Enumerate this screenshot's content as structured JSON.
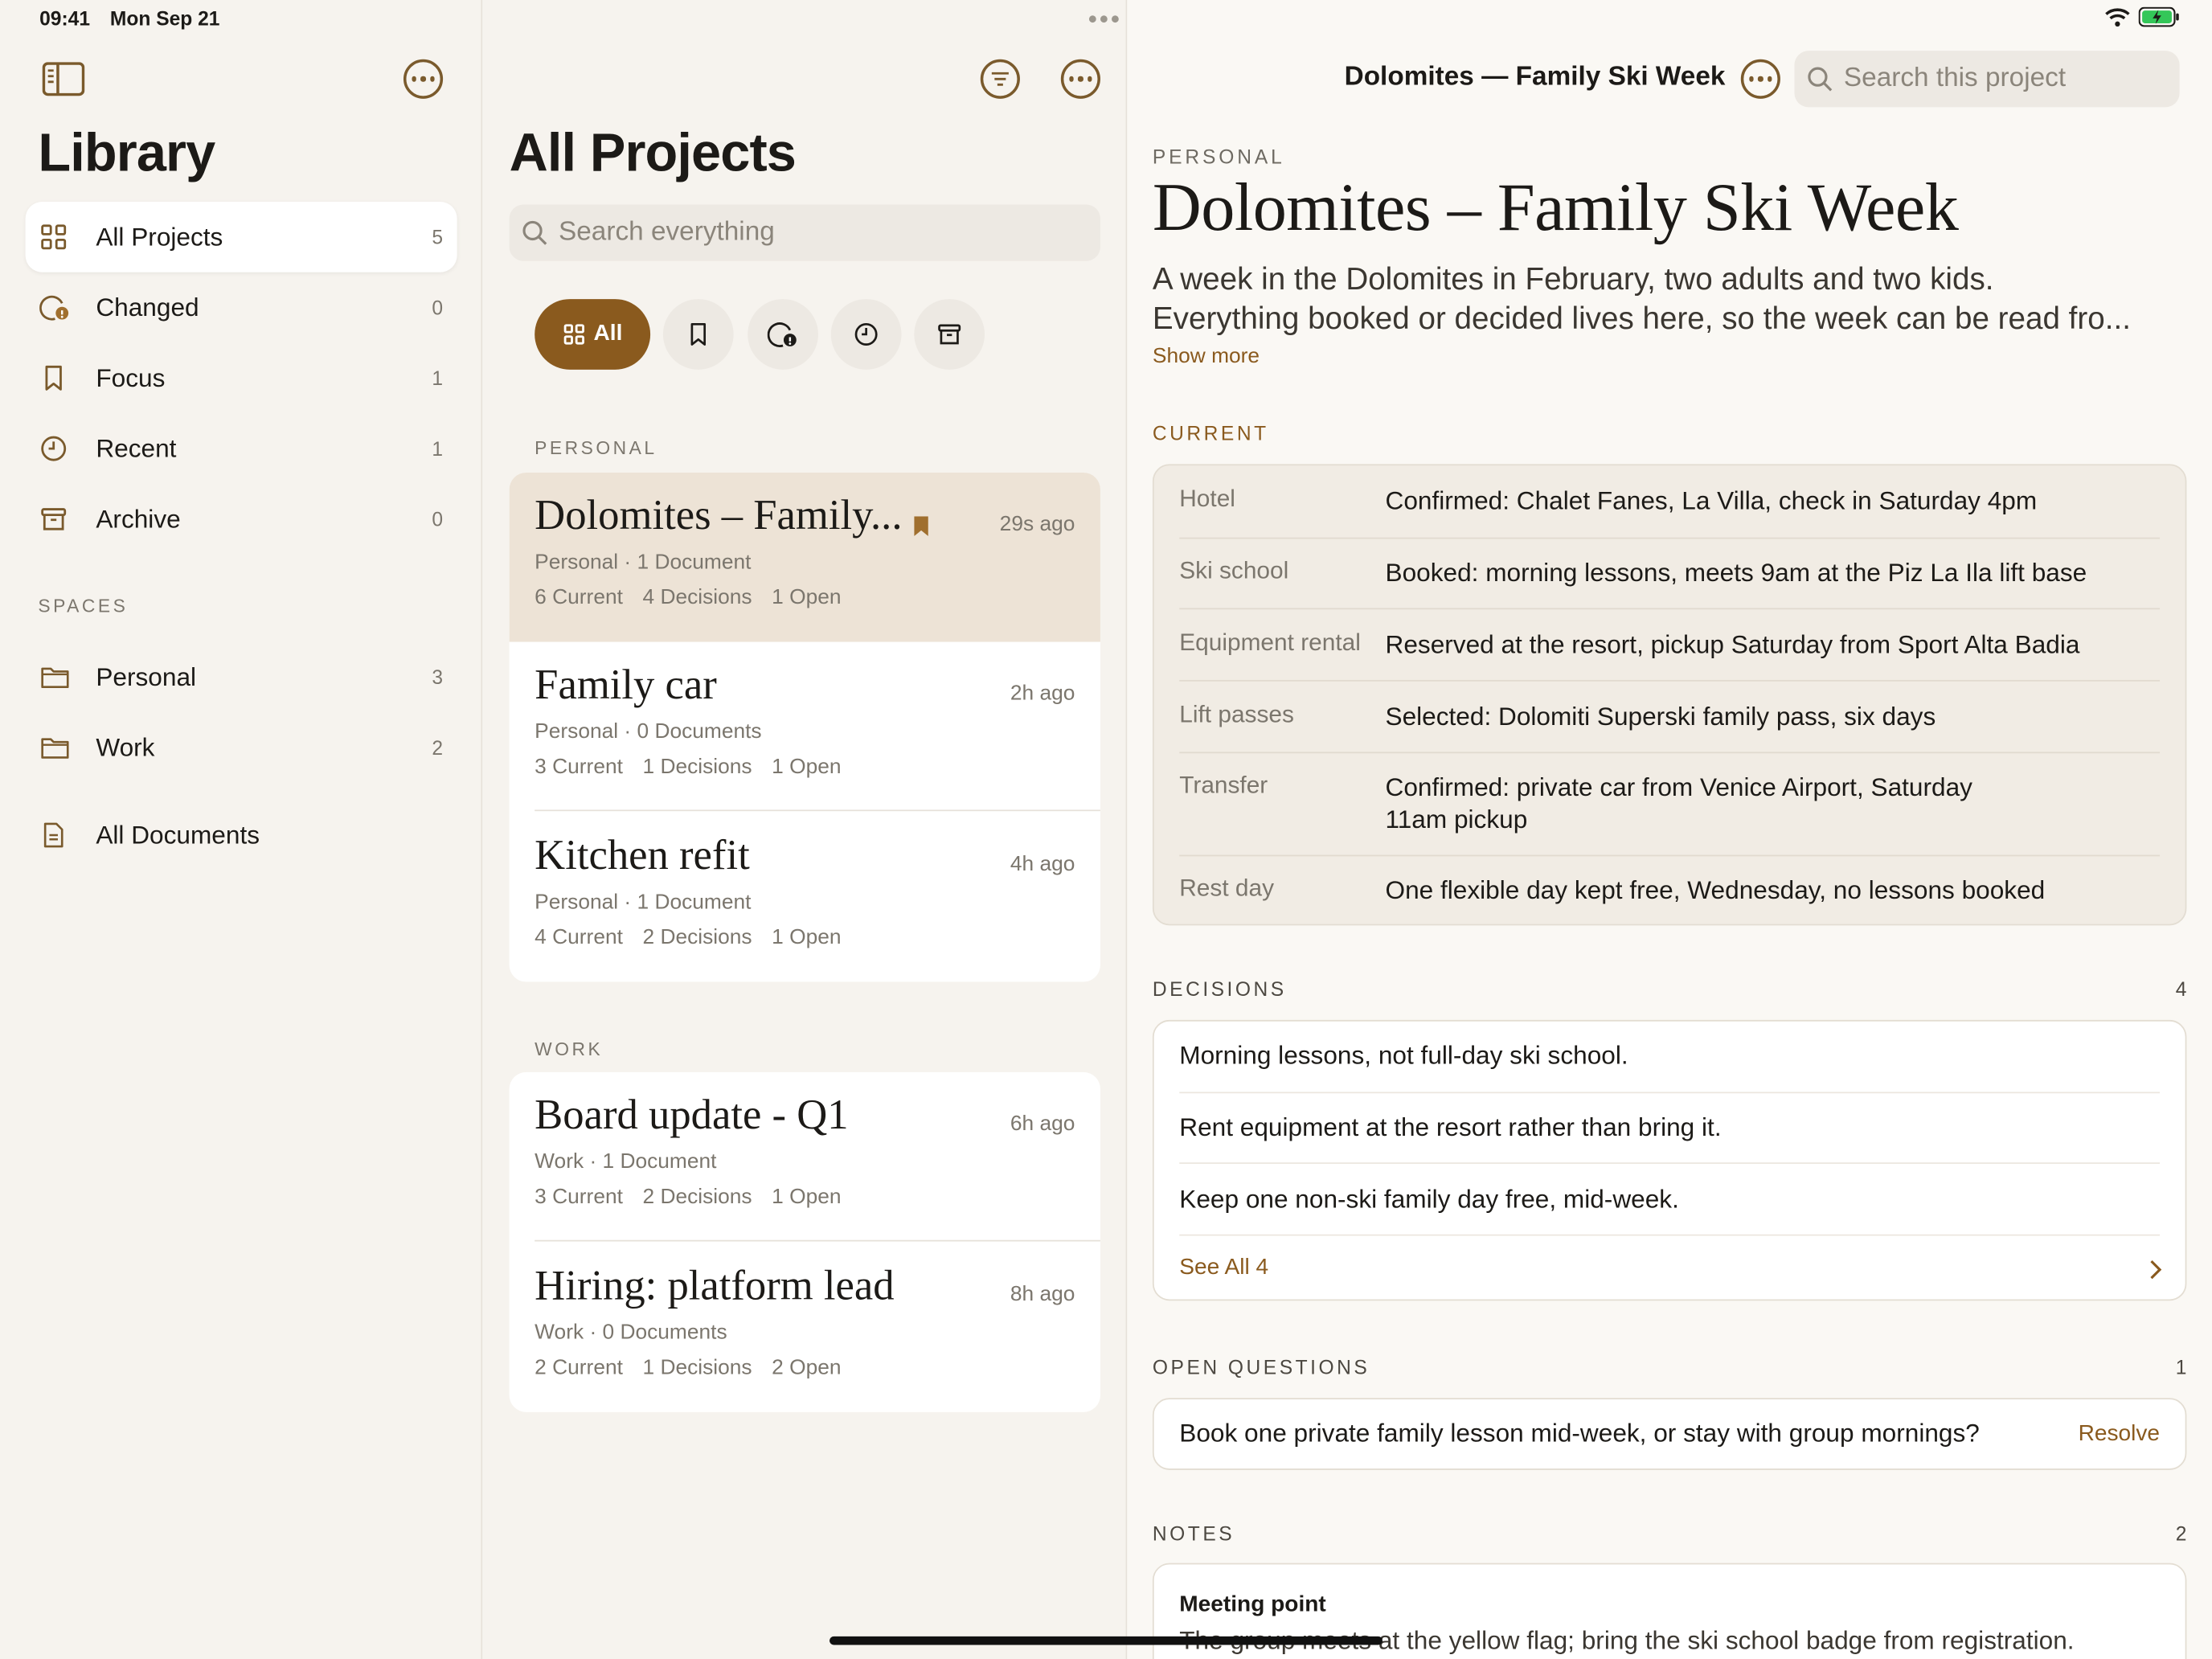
{
  "status": {
    "time": "09:41",
    "date": "Mon Sep 21"
  },
  "sidebar": {
    "title": "Library",
    "items": [
      {
        "label": "All Projects",
        "count": "5",
        "icon": "grid-icon",
        "selected": true
      },
      {
        "label": "Changed",
        "count": "0",
        "icon": "changed-icon"
      },
      {
        "label": "Focus",
        "count": "1",
        "icon": "bookmark-icon"
      },
      {
        "label": "Recent",
        "count": "1",
        "icon": "clock-icon"
      },
      {
        "label": "Archive",
        "count": "0",
        "icon": "archive-icon"
      }
    ],
    "spaces_label": "SPACES",
    "spaces": [
      {
        "label": "Personal",
        "count": "3",
        "icon": "folder-icon"
      },
      {
        "label": "Work",
        "count": "2",
        "icon": "folder-icon"
      }
    ],
    "documents_label": "All Documents"
  },
  "list": {
    "title": "All Projects",
    "search_placeholder": "Search everything",
    "filter_all_label": "All",
    "groups": [
      {
        "label": "PERSONAL",
        "projects": [
          {
            "title": "Dolomites – Family...",
            "time": "29s ago",
            "meta": "Personal · 1 Document",
            "current": "6 Current",
            "decisions": "4 Decisions",
            "open": "1 Open",
            "selected": true,
            "bookmarked": true
          },
          {
            "title": "Family car",
            "time": "2h ago",
            "meta": "Personal · 0 Documents",
            "current": "3 Current",
            "decisions": "1 Decisions",
            "open": "1 Open"
          },
          {
            "title": "Kitchen refit",
            "time": "4h ago",
            "meta": "Personal · 1 Document",
            "current": "4 Current",
            "decisions": "2 Decisions",
            "open": "1 Open"
          }
        ]
      },
      {
        "label": "WORK",
        "projects": [
          {
            "title": "Board update - Q1",
            "time": "6h ago",
            "meta": "Work · 1 Document",
            "current": "3 Current",
            "decisions": "2 Decisions",
            "open": "1 Open"
          },
          {
            "title": "Hiring: platform lead",
            "time": "8h ago",
            "meta": "Work · 0 Documents",
            "current": "2 Current",
            "decisions": "1 Decisions",
            "open": "2 Open"
          }
        ]
      }
    ]
  },
  "detail": {
    "header_title": "Dolomites — Family Ski Week",
    "search_placeholder": "Search this project",
    "kicker": "PERSONAL",
    "title": "Dolomites – Family Ski Week",
    "description_line1": "A week in the Dolomites in February, two adults and two kids.",
    "description_line2": "Everything booked or decided lives here, so the week can be read fro...",
    "show_more": "Show more",
    "current_label": "CURRENT",
    "current": [
      {
        "key": "Hotel",
        "value": "Confirmed: Chalet Fanes, La Villa, check in Saturday 4pm"
      },
      {
        "key": "Ski school",
        "value": "Booked: morning lessons, meets 9am at the Piz La Ila lift base"
      },
      {
        "key": "Equipment rental",
        "value": "Reserved at the resort, pickup Saturday from Sport Alta Badia"
      },
      {
        "key": "Lift passes",
        "value": "Selected: Dolomiti Superski family pass, six days"
      },
      {
        "key": "Transfer",
        "value": "Confirmed: private car from Venice Airport, Saturday 11am pickup"
      },
      {
        "key": "Rest day",
        "value": "One flexible day kept free, Wednesday, no lessons booked"
      }
    ],
    "decisions_label": "DECISIONS",
    "decisions_count": "4",
    "decisions": [
      "Morning lessons, not full-day ski school.",
      "Rent equipment at the resort rather than bring it.",
      "Keep one non-ski family day free, mid-week."
    ],
    "see_all": "See All 4",
    "open_label": "OPEN QUESTIONS",
    "open_count": "1",
    "open_question": "Book one private family lesson mid-week, or stay with group mornings?",
    "resolve": "Resolve",
    "notes_label": "NOTES",
    "notes_count": "2",
    "note_title": "Meeting point",
    "note_body": "The group meets at the yellow flag; bring the ski school badge from registration."
  },
  "colors": {
    "accent": "#8A5A1E",
    "selected_row": "#EDE3D6",
    "background": "#FAF8F4"
  }
}
